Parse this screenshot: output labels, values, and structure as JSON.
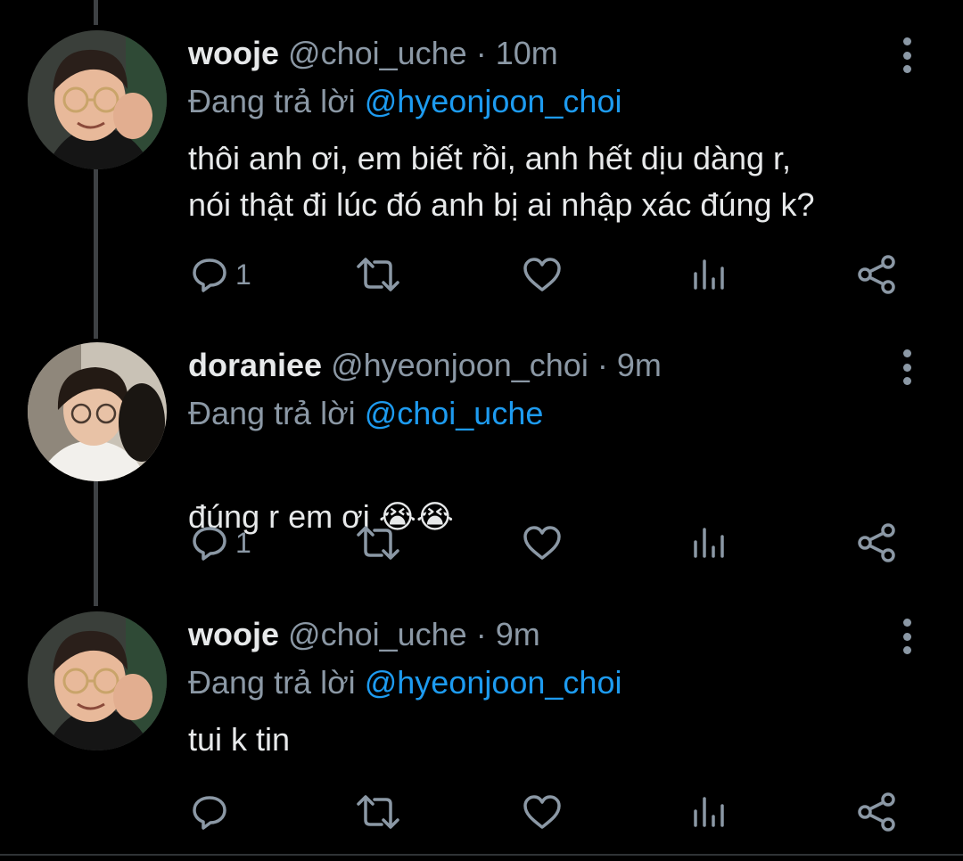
{
  "tweets": [
    {
      "name": "wooje",
      "handle": "@choi_uche",
      "separator": "·",
      "time": "10m",
      "reply_prefix": "Đang trả lời",
      "reply_to": "@hyeonjoon_choi",
      "text": "thôi anh ơi, em biết rồi, anh hết dịu dàng r,\nnói thật đi lúc đó anh bị ai nhập xác đúng k?",
      "reply_count": "1",
      "avatar": "avatar-wooje"
    },
    {
      "name": "doraniee",
      "handle": "@hyeonjoon_choi",
      "separator": "·",
      "time": "9m",
      "reply_prefix": "Đang trả lời",
      "reply_to": "@choi_uche",
      "text": "đúng r em ơi ",
      "emoji": "😭😭",
      "reply_count": "1",
      "avatar": "avatar-doraniee"
    },
    {
      "name": "wooje",
      "handle": "@choi_uche",
      "separator": "·",
      "time": "9m",
      "reply_prefix": "Đang trả lời",
      "reply_to": "@hyeonjoon_choi",
      "text": "tui k tin",
      "reply_count": "",
      "avatar": "avatar-wooje"
    }
  ],
  "icons": [
    "reply-icon",
    "retweet-icon",
    "like-icon",
    "views-icon",
    "share-icon",
    "more-options-icon"
  ],
  "colors": {
    "background": "#000000",
    "text": "#e7e9ea",
    "secondary": "#8b98a5",
    "link": "#1d9bf0",
    "thread_line": "#3e4144"
  }
}
